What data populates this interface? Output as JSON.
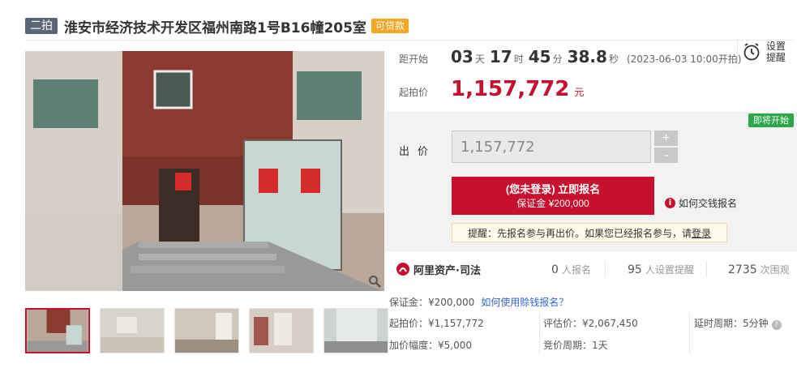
{
  "header": {
    "round_badge": "二拍",
    "title": "淮安市经济技术开发区福州南路1号B16幢205室",
    "loan_tag": "可贷款"
  },
  "gallery": {
    "thumbnail_count": 5,
    "active_index": 0
  },
  "countdown": {
    "label": "距开始",
    "days": "03",
    "days_unit": "天",
    "hours": "17",
    "hours_unit": "时",
    "minutes": "45",
    "minutes_unit": "分",
    "seconds": "38.8",
    "seconds_unit": "秒",
    "start_time": "(2023-06-03 10:00开拍)"
  },
  "reminder": {
    "label": "设置提醒",
    "icon": "alarm-clock-icon"
  },
  "starting_price": {
    "label": "起拍价",
    "value": "1,157,772",
    "unit": "元"
  },
  "bid": {
    "status_badge": "即将开始",
    "label": "出价",
    "input_value": "1,157,772",
    "plus": "+",
    "minus": "-",
    "register_main": "(您未登录) 立即报名",
    "register_sub": "保证金 ¥200,000",
    "howto_label": "如何交钱报名",
    "tip_text": "提醒：先报名参与再出价。如果您已经报名参与，请",
    "tip_link": "登录"
  },
  "brand": {
    "name": "阿里资产·司法",
    "stats": [
      {
        "value": "0",
        "label": "人报名"
      },
      {
        "value": "95",
        "label": "人设置提醒"
      },
      {
        "value": "2735",
        "label": "次围观"
      }
    ]
  },
  "details": {
    "deposit": "保证金：¥200,000",
    "deposit_link": "如何使用赊钱报名？",
    "start_price": "起拍价：¥1,157,772",
    "increment": "加价幅度：¥5,000",
    "appraisal": "评估价：¥2,067,450",
    "bid_period": "竞价周期：1天",
    "delay_period": "延时周期：5分钟"
  },
  "colors": {
    "accent_red": "#c8102e",
    "badge_green": "#2aa84a",
    "loan_orange": "#f5a623",
    "link_blue": "#3366cc"
  }
}
